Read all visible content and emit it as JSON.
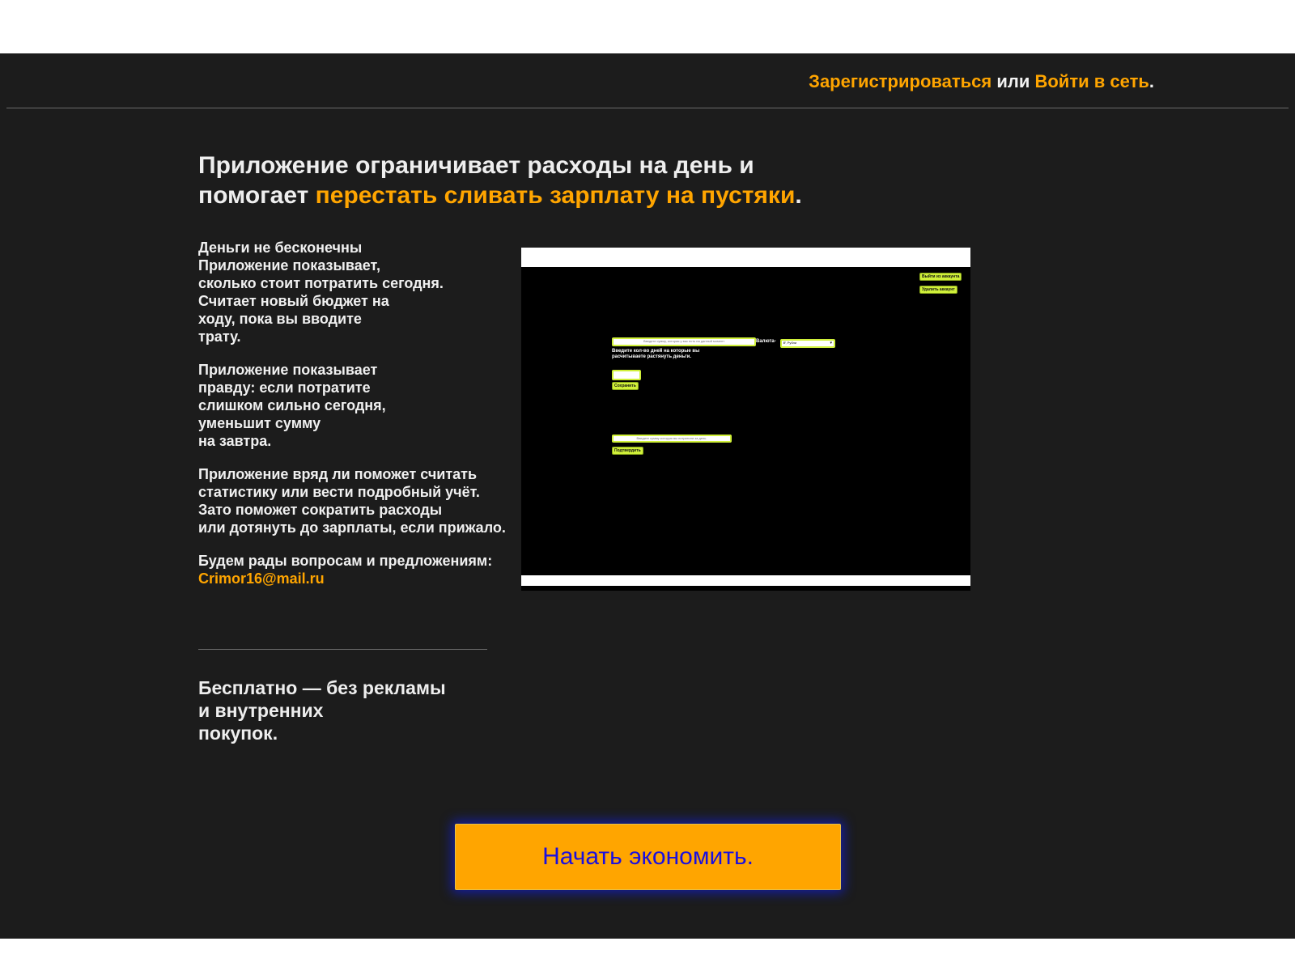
{
  "nav": {
    "register_link": "Зарегистрироваться",
    "or_text": " или ",
    "login_link": "Войти в сеть",
    "period": "."
  },
  "headline": {
    "line1": "Приложение ограничивает расходы на день и",
    "line2_plain": "помогает ",
    "line2_accent": "перестать сливать зарплату на пустяки",
    "line2_end": "."
  },
  "features": {
    "p1": [
      "Деньги не бесконечны",
      "Приложение показывает,",
      "сколько стоит потратить сегодня.",
      "Считает новый бюджет на",
      "ходу, пока вы вводите",
      "трату."
    ],
    "p2": [
      "Приложение показывает",
      "правду: если потратите",
      "слишком сильно сегодня,",
      "уменьшит сумму",
      "на завтра."
    ],
    "p3": [
      "Приложение вряд ли поможет считать",
      "статистику или вести подробный учёт.",
      "Зато поможет сократить расходы",
      "или дотянуть до зарплаты, если прижало."
    ],
    "contact_text": "Будем рады вопросам и предложениям:",
    "email": "Crimor16@mail.ru"
  },
  "free": [
    "Бесплатно — без рекламы",
    "и внутренних",
    "покупок."
  ],
  "cta_label": "Начать экономить.",
  "preview": {
    "logout_button": "Выйти из аккаунта",
    "delete_button": "Удалить аккаунт",
    "amount_placeholder": "Введите сумму, которая у вас есть на данный момент",
    "currency_label": "Валюта-",
    "currency_value": "₽, Рубли",
    "days_text": "Введите кол-во дней на которые вы расчитываете растянуть деньги.",
    "save_button": "Сохранить",
    "spent_placeholder": "Введите сумму которую вы потратили за день.",
    "confirm_button": "Подтвердить"
  },
  "colors": {
    "accent": "#ffa500",
    "background": "#1c1c1c",
    "cta_text": "#1a0fe0",
    "preview_accent": "#d0f03a"
  }
}
